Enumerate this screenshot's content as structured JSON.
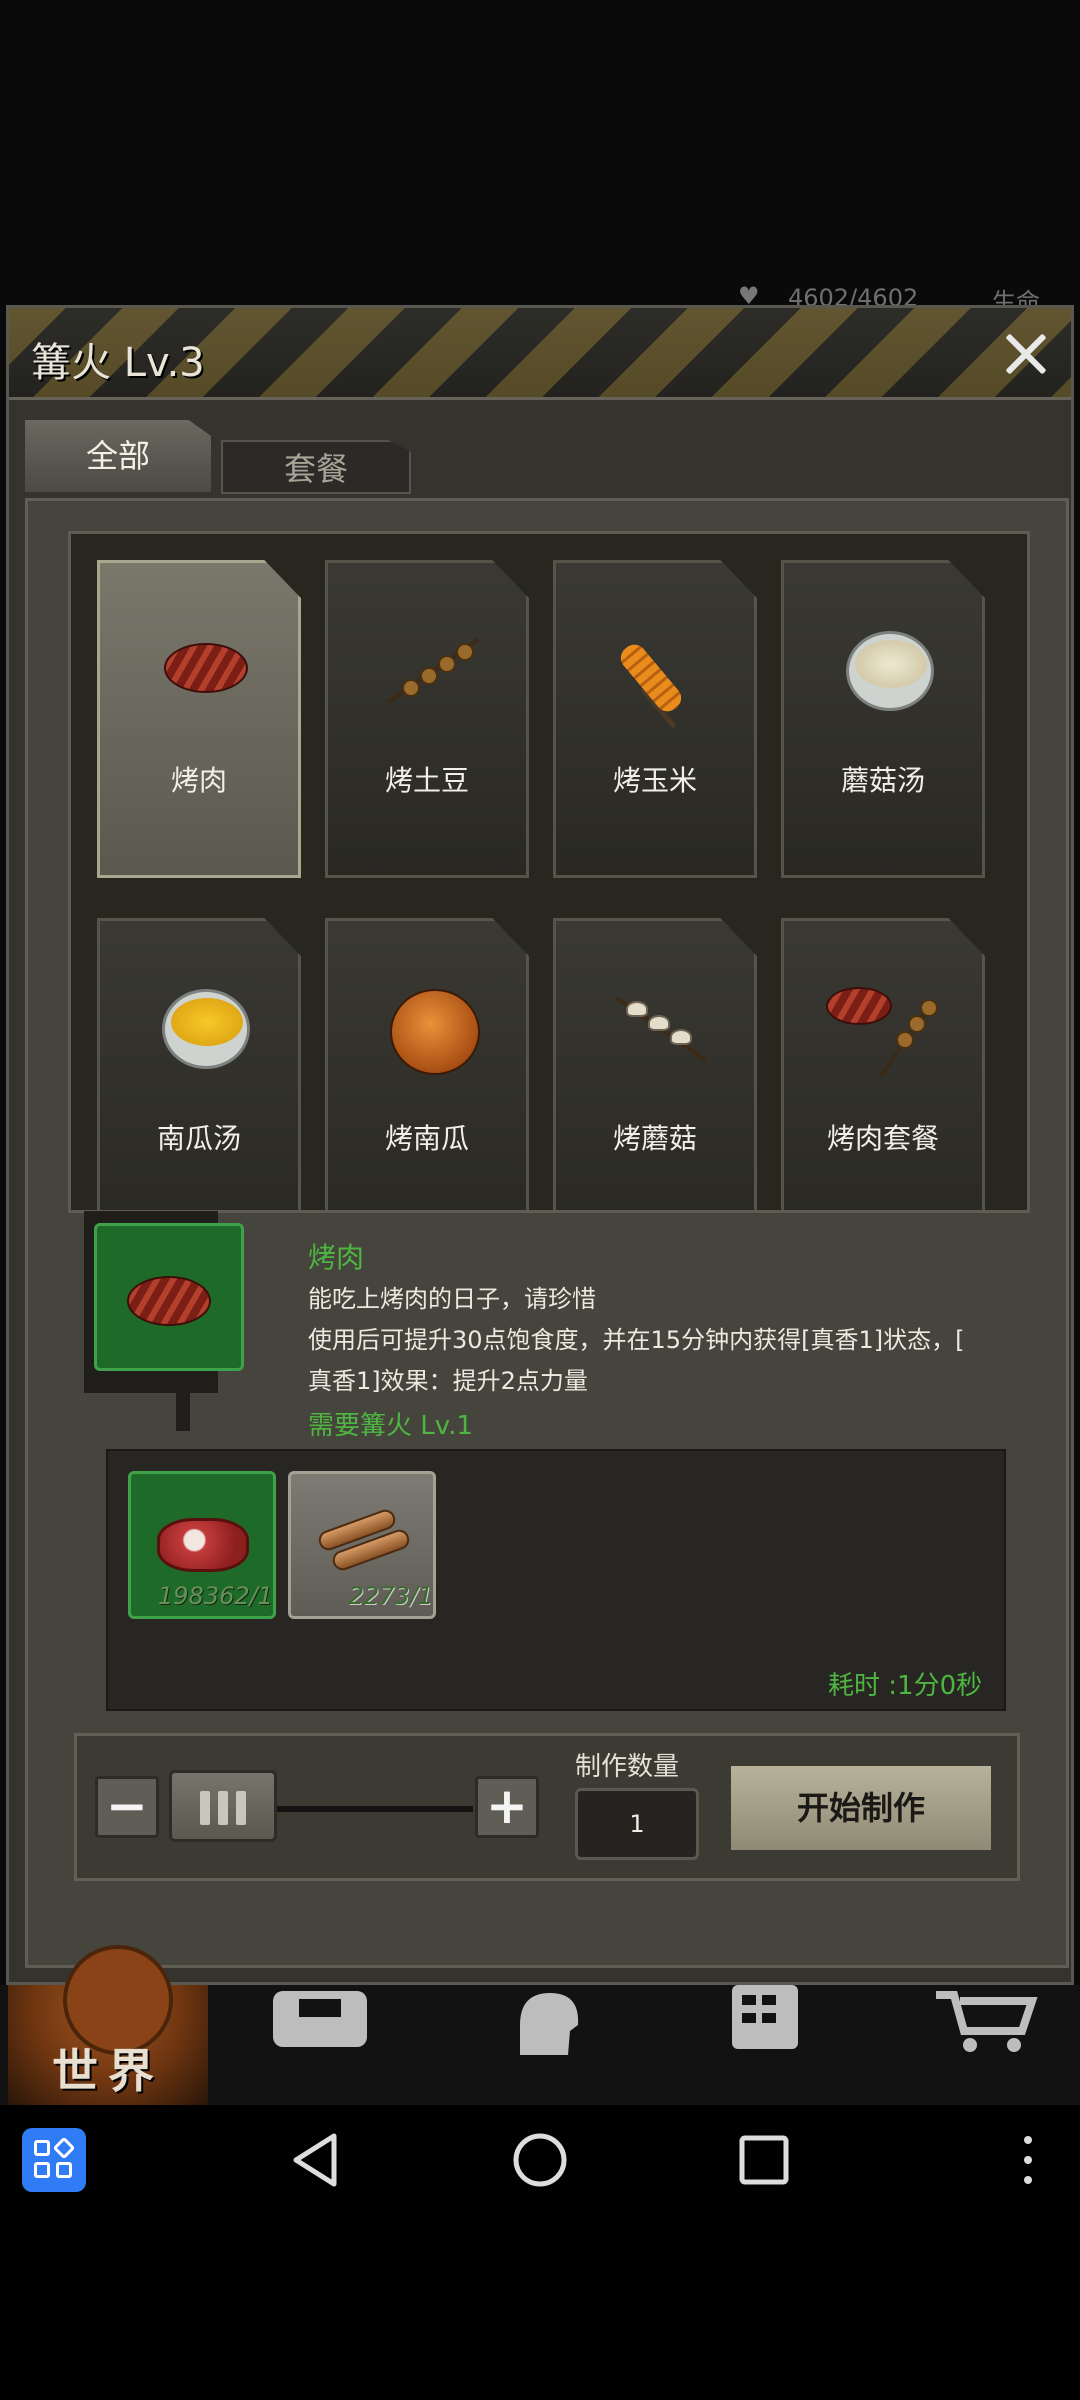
{
  "hud": {
    "hp": "4602/4602",
    "life_label": "生命"
  },
  "dialog": {
    "title": "篝火 Lv.3",
    "tabs": [
      {
        "label": "全部",
        "active": true
      },
      {
        "label": "套餐",
        "active": false
      }
    ],
    "recipes": [
      {
        "name": "烤肉",
        "icon": "steak-icon",
        "selected": true
      },
      {
        "name": "烤土豆",
        "icon": "potato-skewer-icon"
      },
      {
        "name": "烤玉米",
        "icon": "corn-skewer-icon"
      },
      {
        "name": "蘑菇汤",
        "icon": "mushroom-soup-icon"
      },
      {
        "name": "南瓜汤",
        "icon": "pumpkin-soup-icon"
      },
      {
        "name": "烤南瓜",
        "icon": "roasted-pumpkin-icon"
      },
      {
        "name": "烤蘑菇",
        "icon": "mushroom-skewer-icon"
      },
      {
        "name": "烤肉套餐",
        "icon": "meat-set-icon"
      }
    ],
    "detail": {
      "name": "烤肉",
      "description_line1": "能吃上烤肉的日子，请珍惜",
      "description_line2": "使用后可提升30点饱食度，并在15分钟内获得[真香1]状态，[",
      "description_line3": "真香1]效果：提升2点力量",
      "requirement": "需要篝火 Lv.1"
    },
    "materials": [
      {
        "icon": "raw-meat-icon",
        "qty": "198362/1"
      },
      {
        "icon": "wood-log-icon",
        "qty": "2273/1"
      }
    ],
    "time": "耗时 :1分0秒",
    "craft": {
      "qty_label": "制作数量",
      "qty_value": "1",
      "start_label": "开始制作"
    }
  },
  "game_nav": {
    "world_label": "世界"
  },
  "colors": {
    "accent_green": "#4fb541",
    "panel": "#45443d",
    "button": "#b7b29a"
  }
}
